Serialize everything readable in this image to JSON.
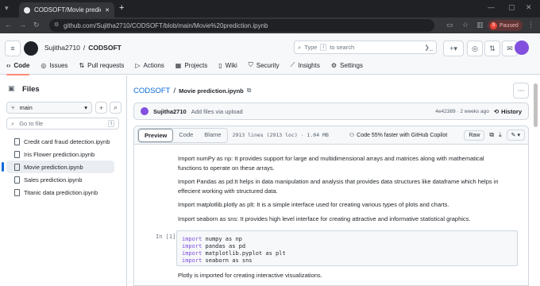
{
  "browser": {
    "tab_title": "CODSOFT/Movie prediction.ipyn",
    "url": "github.com/Sujitha2710/CODSOFT/blob/main/Movie%20prediction.ipynb",
    "profile_initial": "S",
    "profile_status": "Paused"
  },
  "github": {
    "owner": "Sujitha2710",
    "separator": "/",
    "repo": "CODSOFT",
    "search_placeholder": "Type",
    "search_key": "/",
    "search_suffix": "to search",
    "nav": [
      {
        "label": "Code",
        "icon": "code-icon",
        "active": true
      },
      {
        "label": "Issues",
        "icon": "issue-icon"
      },
      {
        "label": "Pull requests",
        "icon": "pull-request-icon"
      },
      {
        "label": "Actions",
        "icon": "play-icon"
      },
      {
        "label": "Projects",
        "icon": "table-icon"
      },
      {
        "label": "Wiki",
        "icon": "book-icon"
      },
      {
        "label": "Security",
        "icon": "shield-icon"
      },
      {
        "label": "Insights",
        "icon": "graph-icon"
      },
      {
        "label": "Settings",
        "icon": "gear-icon"
      }
    ]
  },
  "sidebar": {
    "title": "Files",
    "branch": "main",
    "go_to_file": "Go to file",
    "go_to_file_key": "t",
    "files": [
      {
        "name": "Credit card fraud detection.ipynb"
      },
      {
        "name": "Iris Flower prediction.ipynb"
      },
      {
        "name": "Movie prediction.ipynb",
        "selected": true
      },
      {
        "name": "Sales prediction.ipynb"
      },
      {
        "name": "Titanic data prediction.ipynb"
      }
    ]
  },
  "main": {
    "repo_link": "CODSOFT",
    "path_sep": "/",
    "filename": "Movie prediction.ipynb",
    "commit": {
      "user": "Sujitha2710",
      "message": "Add files via upload",
      "meta": "4e42389 · 2 weeks ago",
      "history": "History"
    },
    "toolbar": {
      "preview": "Preview",
      "code": "Code",
      "blame": "Blame",
      "lines": "2913 lines (2913 loc) · 1.04 MB",
      "copilot": "Code 55% faster with GitHub Copilot",
      "raw": "Raw"
    },
    "paragraphs": [
      "Import numPy as np: It provides support for large and multidimensional arrays and matrices along with mathematical functions to operate on these arrays.",
      "Import Pandas as pd:It helps in data manipulation and analysis that provides data structures like dataframe which helps in effecient working with structured data.",
      "Import matplotlib.plotly as plt: It is a simple interface used for creating various types of plots and charts.",
      "Import seaborn as sns: It provides high level interface for creating attractive and informative statistical graphics."
    ],
    "cell_label": "In [1]:",
    "code_lines": [
      {
        "kw": "import",
        "rest": " numpy as np"
      },
      {
        "kw": "import",
        "rest": " pandas as pd"
      },
      {
        "kw": "import",
        "rest": " matplotlib.pyplot as plt"
      },
      {
        "kw": "import",
        "rest": " seaborn as sns"
      }
    ],
    "after_code": "Plotly is imported for creating interactive visualizations."
  }
}
